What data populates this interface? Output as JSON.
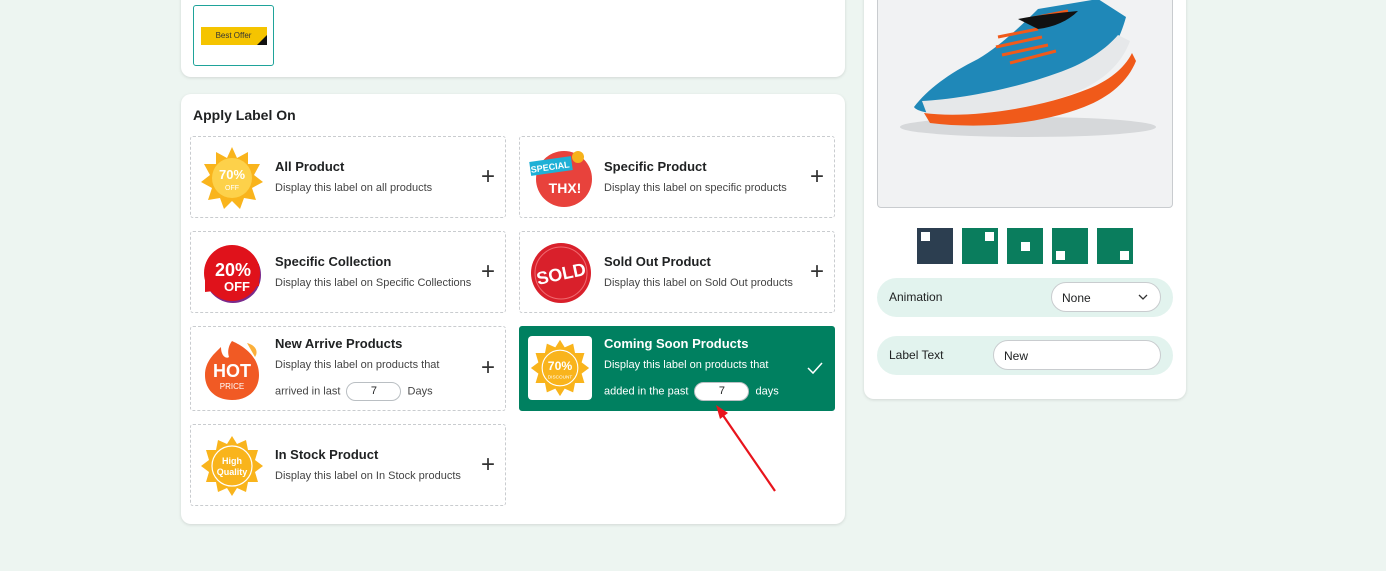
{
  "top_badge": {
    "text": "Best Offer"
  },
  "apply": {
    "title": "Apply Label On",
    "options": [
      {
        "title": "All Product",
        "desc": "Display this label on all products",
        "badge_text": "70%",
        "badge_sub": "OFF"
      },
      {
        "title": "Specific Product",
        "desc": "Display this label on specific products",
        "badge_text": "SPECIAL",
        "badge_sub": "THX!"
      },
      {
        "title": "Specific Collection",
        "desc": "Display this label on Specific Collections",
        "badge_text": "20%",
        "badge_sub": "OFF"
      },
      {
        "title": "Sold Out Product",
        "desc": "Display this label on Sold Out products",
        "badge_text": "SOLD"
      },
      {
        "title": "New Arrive Products",
        "desc_line1": "Display this label on products that",
        "desc_prefix": "arrived in last",
        "days_value": "7",
        "desc_suffix": "Days",
        "badge_text": "HOT",
        "badge_sub": "PRICE"
      },
      {
        "title": "Coming Soon Products",
        "desc_line1": "Display this label on products that",
        "desc_prefix": "added in the past",
        "days_value": "7",
        "desc_suffix": "days",
        "badge_text": "70%",
        "badge_sub": "DISCOUNT",
        "selected": true
      },
      {
        "title": "In Stock Product",
        "desc": "Display this label on In Stock products",
        "badge_text": "High",
        "badge_sub": "Quality"
      }
    ]
  },
  "preview": {
    "animation_label": "Animation",
    "animation_value": "None",
    "label_text_label": "Label Text",
    "label_text_value": "New"
  },
  "colors": {
    "primary": "#008060",
    "background": "#edf5f1",
    "position_active": "#2c3e50"
  }
}
